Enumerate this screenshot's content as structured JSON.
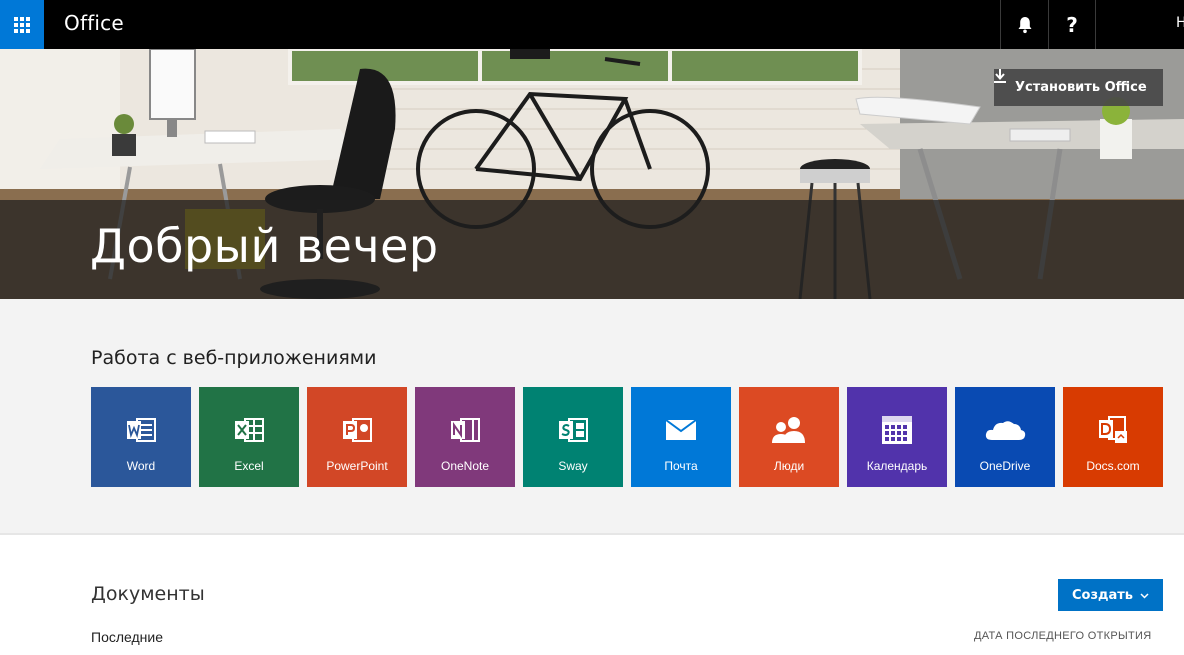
{
  "header": {
    "brand": "Office",
    "user_initial": "Н",
    "help_label": "?"
  },
  "hero": {
    "greeting": "Добрый вечер",
    "install_label": "Установить Office"
  },
  "apps": {
    "title": "Работа с веб-приложениями",
    "tiles": [
      {
        "label": "Word",
        "color": "#2b579a",
        "icon": "word-icon"
      },
      {
        "label": "Excel",
        "color": "#217346",
        "icon": "excel-icon"
      },
      {
        "label": "PowerPoint",
        "color": "#d24726",
        "icon": "powerpoint-icon"
      },
      {
        "label": "OneNote",
        "color": "#80397b",
        "icon": "onenote-icon"
      },
      {
        "label": "Sway",
        "color": "#008272",
        "icon": "sway-icon"
      },
      {
        "label": "Почта",
        "color": "#0078d7",
        "icon": "mail-icon"
      },
      {
        "label": "Люди",
        "color": "#dc4a23",
        "icon": "people-icon"
      },
      {
        "label": "Календарь",
        "color": "#5133ab",
        "icon": "calendar-icon"
      },
      {
        "label": "OneDrive",
        "color": "#094ab2",
        "icon": "onedrive-icon"
      },
      {
        "label": "Docs.com",
        "color": "#d83b01",
        "icon": "docs-icon"
      }
    ]
  },
  "documents": {
    "title": "Документы",
    "create_label": "Создать",
    "recent_label": "Последние",
    "sort_label": "ДАТА ПОСЛЕДНЕГО ОТКРЫТИЯ"
  },
  "colors": {
    "accent": "#0078d7",
    "topbar": "#000000"
  }
}
